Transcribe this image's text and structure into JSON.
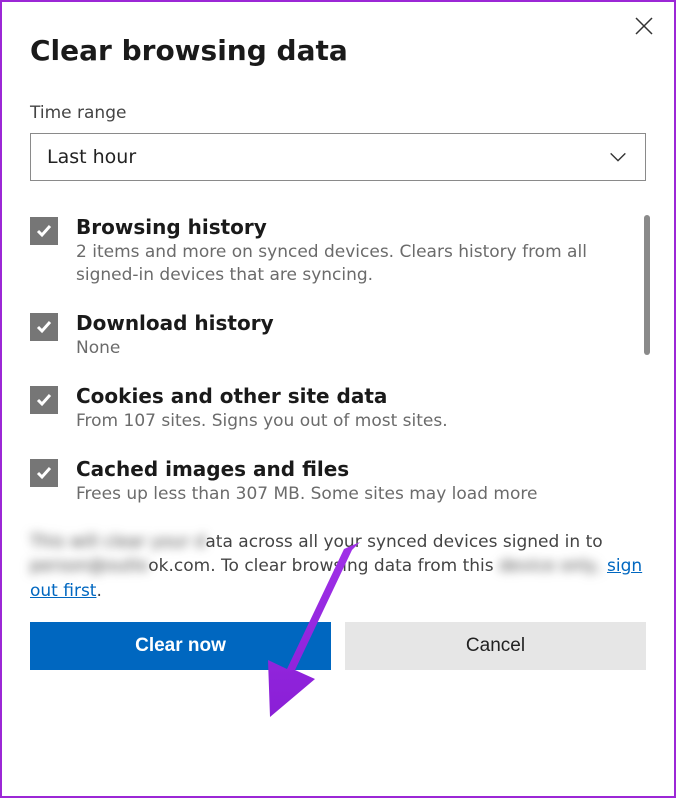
{
  "dialog": {
    "title": "Clear browsing data",
    "time_range_label": "Time range",
    "time_range_value": "Last hour"
  },
  "options": [
    {
      "label": "Browsing history",
      "desc": "2 items and more on synced devices. Clears history from all signed-in devices that are syncing."
    },
    {
      "label": "Download history",
      "desc": "None"
    },
    {
      "label": "Cookies and other site data",
      "desc": "From 107 sites. Signs you out of most sites."
    },
    {
      "label": "Cached images and files",
      "desc": "Frees up less than 307 MB. Some sites may load more"
    }
  ],
  "footer": {
    "part1_blur": "This will clear your d",
    "part2": "ata across all your synced devices signed in to ",
    "part3_blur": "person@outlo",
    "part4": "ok.com. To clear browsing data from this ",
    "part5_blur": "device only, ",
    "link": "sign out first",
    "period": "."
  },
  "buttons": {
    "clear": "Clear now",
    "cancel": "Cancel"
  }
}
